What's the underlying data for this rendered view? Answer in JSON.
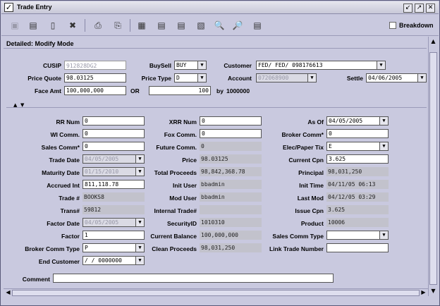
{
  "window": {
    "title": "Trade Entry",
    "checkbox": "✓",
    "buttons": {
      "minimize": "↙",
      "maximize": "↗",
      "close": "✕"
    }
  },
  "toolbar": {
    "icons": [
      "save-icon",
      "save-as-icon",
      "new-document-icon",
      "delete-icon",
      "print-icon",
      "print-preview-icon",
      "grid-add-icon",
      "grid-edit-icon",
      "grid-insert-icon",
      "grid-delete-icon",
      "find-icon",
      "find-next-icon",
      "report-icon"
    ],
    "breakdown_label": "Breakdown"
  },
  "section": {
    "title": "Detailed: Modify Mode"
  },
  "header": {
    "cusip_label": "CUSIP",
    "cusip": "912828DG2",
    "buysell_label": "BuySell",
    "buysell": "BUY",
    "customer_label": "Customer",
    "customer": "FED/ FED/ 098176613",
    "price_quote_label": "Price Quote",
    "price_quote": "98.03125",
    "price_type_label": "Price Type",
    "price_type": "D",
    "account_label": "Account",
    "account": "072068900",
    "settle_label": "Settle",
    "settle": "04/06/2005",
    "face_amt_label": "Face Amt",
    "face_amt": "100,000,000",
    "or_label": "OR",
    "or_value": "100",
    "by_label": "by",
    "by_value": "1000000"
  },
  "detail": {
    "rr_num_label": "RR Num",
    "rr_num": "0",
    "xrr_num_label": "XRR Num",
    "xrr_num": "0",
    "as_of_label": "As Of",
    "as_of": "04/05/2005",
    "wi_comm_label": "WI Comm.",
    "wi_comm": "0",
    "fox_comm_label": "Fox Comm.",
    "fox_comm": "0",
    "broker_comm_label": "Broker Comm*",
    "broker_comm": "0",
    "sales_comm_label": "Sales Comm*",
    "sales_comm": "0",
    "future_comm_label": "Future Comm.",
    "future_comm": "0",
    "elec_paper_label": "Elec/Paper Tix",
    "elec_paper": "E",
    "trade_date_label": "Trade Date",
    "trade_date": "04/05/2005",
    "price_label": "Price",
    "price": "98.03125",
    "current_cpn_label": "Current Cpn",
    "current_cpn": "3.625",
    "maturity_date_label": "Maturity Date",
    "maturity_date": "01/15/2010",
    "total_proceeds_label": "Total Proceeds",
    "total_proceeds": "98,842,368.78",
    "principal_label": "Principal",
    "principal": "98,031,250",
    "accrued_int_label": "Accrued Int",
    "accrued_int": "811,118.78",
    "init_user_label": "Init User",
    "init_user": "bbadmin",
    "init_time_label": "Init Time",
    "init_time": "04/11/05 06:13",
    "trade_num_label": "Trade #",
    "trade_num": "BOOKS8",
    "mod_user_label": "Mod User",
    "mod_user": "bbadmin",
    "last_mod_label": "Last Mod",
    "last_mod": "04/12/05 03:29",
    "trans_num_label": "Trans#",
    "trans_num": "59812",
    "internal_trade_label": "Internal Trade#",
    "internal_trade": "",
    "issue_cpn_label": "Issue Cpn",
    "issue_cpn": "3.625",
    "factor_date_label": "Factor Date",
    "factor_date": "04/05/2005",
    "security_id_label": "SecurityID",
    "security_id": "1010310",
    "product_label": "Product",
    "product": "10006",
    "factor_label": "Factor",
    "factor": "1",
    "current_balance_label": "Current Balance",
    "current_balance": "100,000,000",
    "sales_comm_type_label": "Sales Comm Type",
    "sales_comm_type": "",
    "broker_comm_type_label": "Broker Comm Type",
    "broker_comm_type": "P",
    "clean_proceeds_label": "Clean Proceeds",
    "clean_proceeds": "98,031,250",
    "link_trade_label": "Link Trade Number",
    "link_trade": "",
    "end_customer_label": "End Customer",
    "end_customer": "/ / 0000000",
    "comment_label": "Comment",
    "comment": ""
  }
}
